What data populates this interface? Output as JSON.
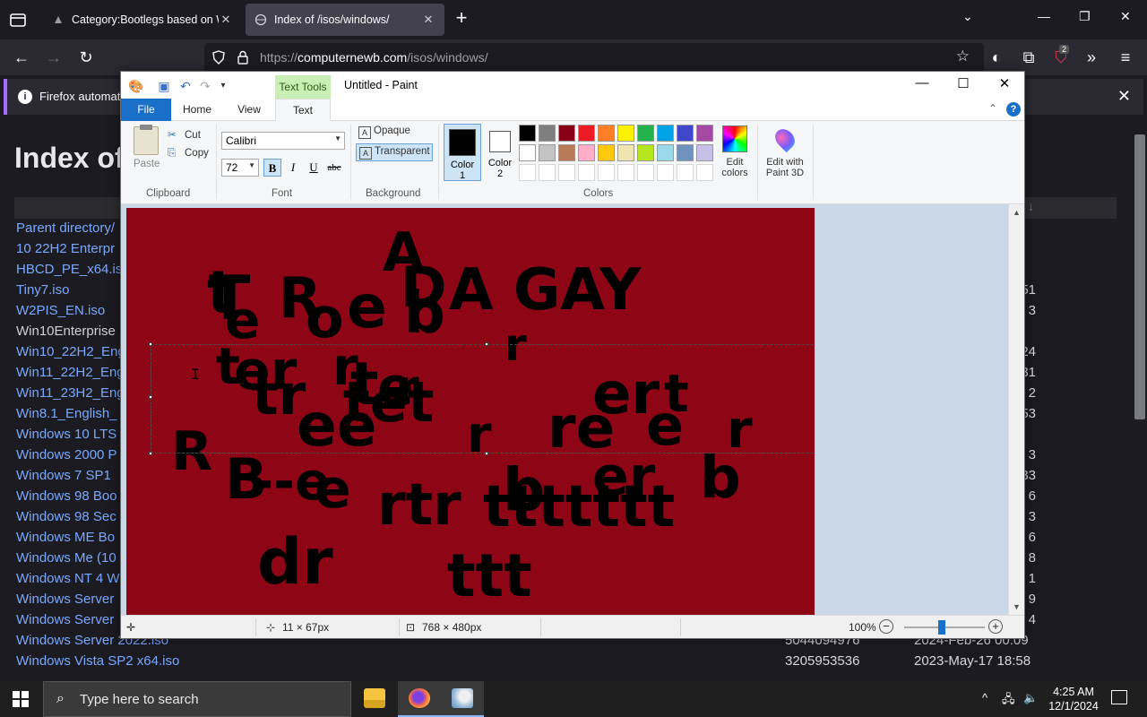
{
  "browser": {
    "tabs": [
      {
        "title": "Category:Bootlegs based on Wi",
        "active": false
      },
      {
        "title": "Index of /isos/windows/",
        "active": true
      }
    ],
    "url": {
      "prefix": "https://",
      "host": "computernewb.com",
      "path": "/isos/windows/"
    },
    "notification": {
      "text": "Firefox automatic"
    },
    "extension_badge": "2"
  },
  "page": {
    "title": "Index of",
    "rows": [
      {
        "name": "Parent directory/",
        "size": "",
        "date": "",
        "frag": ""
      },
      {
        "name": "10 22H2 Enterpr",
        "size": "",
        "date": "",
        "frag": ""
      },
      {
        "name": "HBCD_PE_x64.iso",
        "size": "",
        "date": "",
        "frag": ""
      },
      {
        "name": "Tiny7.iso",
        "size": "",
        "date": "",
        "frag": "51"
      },
      {
        "name": "W2PIS_EN.iso",
        "size": "",
        "date": "",
        "frag": "3"
      },
      {
        "name": "Win10Enterprise",
        "size": "",
        "date": "",
        "frag": "",
        "visited": true
      },
      {
        "name": "Win10_22H2_Eng",
        "size": "",
        "date": "",
        "frag": "24"
      },
      {
        "name": "Win11_22H2_Eng",
        "size": "",
        "date": "",
        "frag": "31"
      },
      {
        "name": "Win11_23H2_Eng",
        "size": "",
        "date": "",
        "frag": "2"
      },
      {
        "name": "Win8.1_English_",
        "size": "",
        "date": "",
        "frag": "53"
      },
      {
        "name": "Windows 10 LTS",
        "size": "",
        "date": "",
        "frag": ""
      },
      {
        "name": "Windows 2000 P",
        "size": "",
        "date": "",
        "frag": "3"
      },
      {
        "name": "Windows 7 SP1 ",
        "size": "",
        "date": "",
        "frag": "33"
      },
      {
        "name": "Windows 98 Boo",
        "size": "",
        "date": "",
        "frag": "6"
      },
      {
        "name": "Windows 98 Sec",
        "size": "",
        "date": "",
        "frag": "3"
      },
      {
        "name": "Windows ME Bo",
        "size": "",
        "date": "",
        "frag": "6"
      },
      {
        "name": "Windows Me (10",
        "size": "",
        "date": "",
        "frag": "8"
      },
      {
        "name": "Windows NT 4 W",
        "size": "",
        "date": "",
        "frag": "1"
      },
      {
        "name": "Windows Server",
        "size": "",
        "date": "",
        "frag": "9"
      },
      {
        "name": "Windows Server",
        "size": "",
        "date": "",
        "frag": "4"
      },
      {
        "name": "Windows Server 2022.iso",
        "size": "5044094976",
        "date": "2024-Feb-26 00:09",
        "frag": ""
      },
      {
        "name": "Windows Vista SP2 x64.iso",
        "size": "3205953536",
        "date": "2023-May-17 18:58",
        "frag": ""
      }
    ]
  },
  "paint": {
    "title": "Untitled - Paint",
    "context_tab": "Text Tools",
    "tabs": {
      "file": "File",
      "home": "Home",
      "view": "View",
      "text": "Text"
    },
    "clipboard": {
      "paste": "Paste",
      "cut": "Cut",
      "copy": "Copy",
      "label": "Clipboard"
    },
    "font": {
      "family": "Calibri",
      "size": "72",
      "label": "Font",
      "bold": "B",
      "italic": "I",
      "underline": "U",
      "strike": "abc"
    },
    "background": {
      "opaque": "Opaque",
      "transparent": "Transparent",
      "label": "Background"
    },
    "colors": {
      "color1_line1": "Color",
      "color1_line2": "1",
      "color2_line1": "Color",
      "color2_line2": "2",
      "color1": "#000000",
      "color2": "#ffffff",
      "label": "Colors",
      "edit_line1": "Edit",
      "edit_line2": "colors",
      "palette_row1": [
        "#000000",
        "#7f7f7f",
        "#880015",
        "#ed1c24",
        "#ff7f27",
        "#fff200",
        "#22b14c",
        "#00a2e8",
        "#3f48cc",
        "#a349a4"
      ],
      "palette_row2": [
        "#ffffff",
        "#c3c3c3",
        "#b97a57",
        "#ffaec9",
        "#ffc90e",
        "#efe4b0",
        "#b5e61d",
        "#99d9ea",
        "#7092be",
        "#c8bfe7"
      ]
    },
    "paint3d": {
      "line1": "Edit with",
      "line2": "Paint 3D"
    },
    "canvas_bg": "#8e0516",
    "canvas_texts": [
      "A",
      "D",
      "A GAY",
      "t",
      "T",
      "R",
      "e",
      "b",
      "o",
      "e",
      "r",
      "t",
      "er",
      "r",
      "t",
      "e",
      "r",
      "tr",
      "tet",
      "er",
      "t",
      "ee",
      "r",
      "re",
      "e",
      "r",
      "R",
      "B",
      "--e",
      "e",
      "b",
      "er",
      "b",
      "rtr",
      "ttttttt",
      "dr",
      "ttt"
    ],
    "status": {
      "cursor_pos": "11 × 67px",
      "canvas_size": "768 × 480px",
      "zoom": "100%"
    }
  },
  "taskbar": {
    "search_placeholder": "Type here to search",
    "time": "4:25 AM",
    "date": "12/1/2024"
  }
}
